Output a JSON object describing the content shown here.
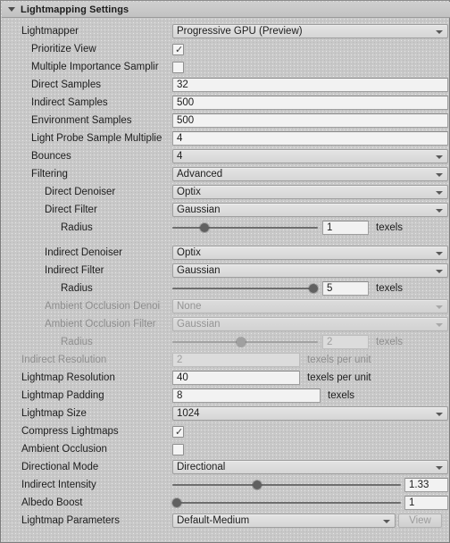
{
  "header": {
    "title": "Lightmapping Settings",
    "foldout_icon": "triangle-down-icon",
    "expanded": true
  },
  "rows": [
    {
      "label": "Lightmapper",
      "indent": 0,
      "type": "dropdown",
      "value": "Progressive GPU (Preview)",
      "enabled": true
    },
    {
      "label": "Prioritize View",
      "indent": 1,
      "type": "checkbox",
      "value": true,
      "enabled": true
    },
    {
      "label": "Multiple Importance Samplir",
      "indent": 1,
      "type": "checkbox",
      "value": false,
      "enabled": true
    },
    {
      "label": "Direct Samples",
      "indent": 1,
      "type": "text",
      "value": "32",
      "enabled": true
    },
    {
      "label": "Indirect Samples",
      "indent": 1,
      "type": "text",
      "value": "500",
      "enabled": true
    },
    {
      "label": "Environment Samples",
      "indent": 1,
      "type": "text",
      "value": "500",
      "enabled": true
    },
    {
      "label": "Light Probe Sample Multiplie",
      "indent": 1,
      "type": "text",
      "value": "4",
      "enabled": true
    },
    {
      "label": "Bounces",
      "indent": 1,
      "type": "dropdown",
      "value": "4",
      "enabled": true
    },
    {
      "label": "Filtering",
      "indent": 1,
      "type": "dropdown",
      "value": "Advanced",
      "enabled": true
    },
    {
      "label": "Direct Denoiser",
      "indent": 2,
      "type": "dropdown",
      "value": "Optix",
      "enabled": true
    },
    {
      "label": "Direct Filter",
      "indent": 2,
      "type": "dropdown",
      "value": "Gaussian",
      "enabled": true
    },
    {
      "label": "Radius",
      "indent": 3,
      "type": "slider",
      "value": "1",
      "unit": "texels",
      "fill": 0.22,
      "enabled": true
    },
    {
      "label": "Indirect Denoiser",
      "indent": 2,
      "type": "dropdown",
      "value": "Optix",
      "enabled": true
    },
    {
      "label": "Indirect Filter",
      "indent": 2,
      "type": "dropdown",
      "value": "Gaussian",
      "enabled": true
    },
    {
      "label": "Radius",
      "indent": 3,
      "type": "slider",
      "value": "5",
      "unit": "texels",
      "fill": 0.97,
      "enabled": true
    },
    {
      "label": "Ambient Occlusion Denoi",
      "indent": 2,
      "type": "dropdown",
      "value": "None",
      "enabled": false
    },
    {
      "label": "Ambient Occlusion Filter",
      "indent": 2,
      "type": "dropdown",
      "value": "Gaussian",
      "enabled": false
    },
    {
      "label": "Radius",
      "indent": 3,
      "type": "slider",
      "value": "2",
      "unit": "texels",
      "fill": 0.47,
      "enabled": false
    },
    {
      "label": "Indirect Resolution",
      "indent": 0,
      "type": "text",
      "value": "2",
      "unit": "texels per unit",
      "enabled": false
    },
    {
      "label": "Lightmap Resolution",
      "indent": 0,
      "type": "text",
      "value": "40",
      "unit": "texels per unit",
      "enabled": true
    },
    {
      "label": "Lightmap Padding",
      "indent": 0,
      "type": "text",
      "value": "8",
      "unit": "texels",
      "enabled": true
    },
    {
      "label": "Lightmap Size",
      "indent": 0,
      "type": "dropdown",
      "value": "1024",
      "enabled": true
    },
    {
      "label": "Compress Lightmaps",
      "indent": 0,
      "type": "checkbox",
      "value": true,
      "enabled": true
    },
    {
      "label": "Ambient Occlusion",
      "indent": 0,
      "type": "checkbox",
      "value": false,
      "enabled": true
    },
    {
      "label": "Directional Mode",
      "indent": 0,
      "type": "dropdown",
      "value": "Directional",
      "enabled": true
    },
    {
      "label": "Indirect Intensity",
      "indent": 0,
      "type": "wideslider",
      "value": "1.33",
      "fill": 0.37,
      "enabled": true
    },
    {
      "label": "Albedo Boost",
      "indent": 0,
      "type": "wideslider",
      "value": "1",
      "fill": 0.02,
      "enabled": true
    },
    {
      "label": "Lightmap Parameters",
      "indent": 0,
      "type": "dropdown-view",
      "value": "Default-Medium",
      "button": "View",
      "enabled": true
    }
  ]
}
